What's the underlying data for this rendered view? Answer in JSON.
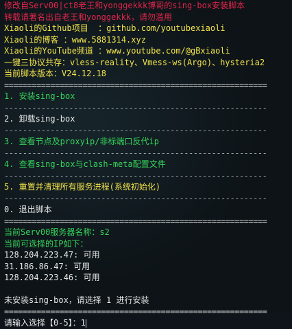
{
  "header": {
    "red1": "修改自Serv00|ct8老王和yonggekkk博哥的sing-box安装脚本",
    "red2": "转载请著名出自老王和yonggekkk，请勿滥用",
    "y1": "Xiaoli的Github项目  ：github.com/youtubexiaoli",
    "y2": "Xiaoli的博客 ：www.5881314.xyz",
    "y3": "Xiaoli的YouTube频道 ：www.youtube.com/@gBxiaoli",
    "y4": "一键三协议共存：vless-reality、Vmess-ws(Argo)、hysteria2",
    "y5": "当前脚本版本：V24.12.18"
  },
  "separators": {
    "eq": "=========================================================",
    "dash": "---------------------------------------------------------"
  },
  "menu": [
    {
      "label": "1. 安装sing-box"
    },
    {
      "label": "2. 卸载sing-box"
    },
    {
      "label": "3. 查看节点及proxyip/非标端口反代ip"
    },
    {
      "label": "4. 查看sing-box与clash-meta配置文件"
    },
    {
      "label": "5. 重置并清理所有服务进程(系统初始化)"
    },
    {
      "label": "0. 退出脚本"
    }
  ],
  "server": {
    "name_line": "当前Serv00服务器名称：s2",
    "ips_title": "当前可选择的IP如下：",
    "ips": [
      "128.204.223.47: 可用",
      "31.186.86.47: 可用",
      "128.204.223.46: 可用"
    ]
  },
  "status": "未安装sing-box，请选择 1 进行安装",
  "prompt": "请输入选择【0-5】：1"
}
